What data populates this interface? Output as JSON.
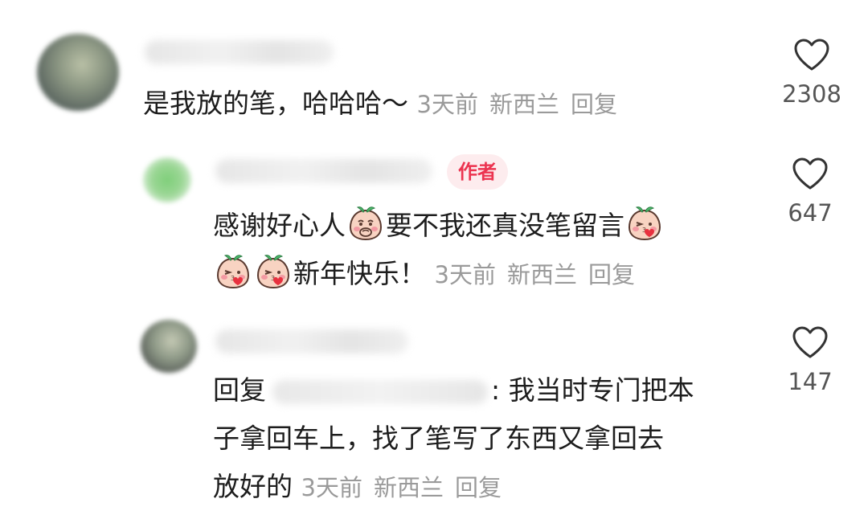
{
  "comments": [
    {
      "text": "是我放的笔，哈哈哈～",
      "time": "3天前",
      "location": "新西兰",
      "reply_label": "回复",
      "likes": "2308"
    },
    {
      "badge": "作者",
      "text_line1_a": "感谢好心人",
      "text_line1_b": "要不我还真没笔留言",
      "text_line2": "新年快乐！",
      "time": "3天前",
      "location": "新西兰",
      "reply_label": "回复",
      "likes": "647"
    },
    {
      "reply_prefix": "回复",
      "text_line1": ": 我当时专门把本",
      "text_line2": "子拿回车上，找了笔写了东西又拿回去",
      "text_line3": "放好的",
      "time": "3天前",
      "location": "新西兰",
      "reply_label": "回复",
      "likes": "147"
    }
  ],
  "icons": {
    "like": "heart-outline-icon",
    "emoji_shy": "peach-shy-emoji",
    "emoji_kiss": "peach-kiss-emoji"
  },
  "colors": {
    "badge_text": "#ec3450",
    "badge_bg": "#fdecee",
    "meta_text": "#9a9a9a"
  }
}
